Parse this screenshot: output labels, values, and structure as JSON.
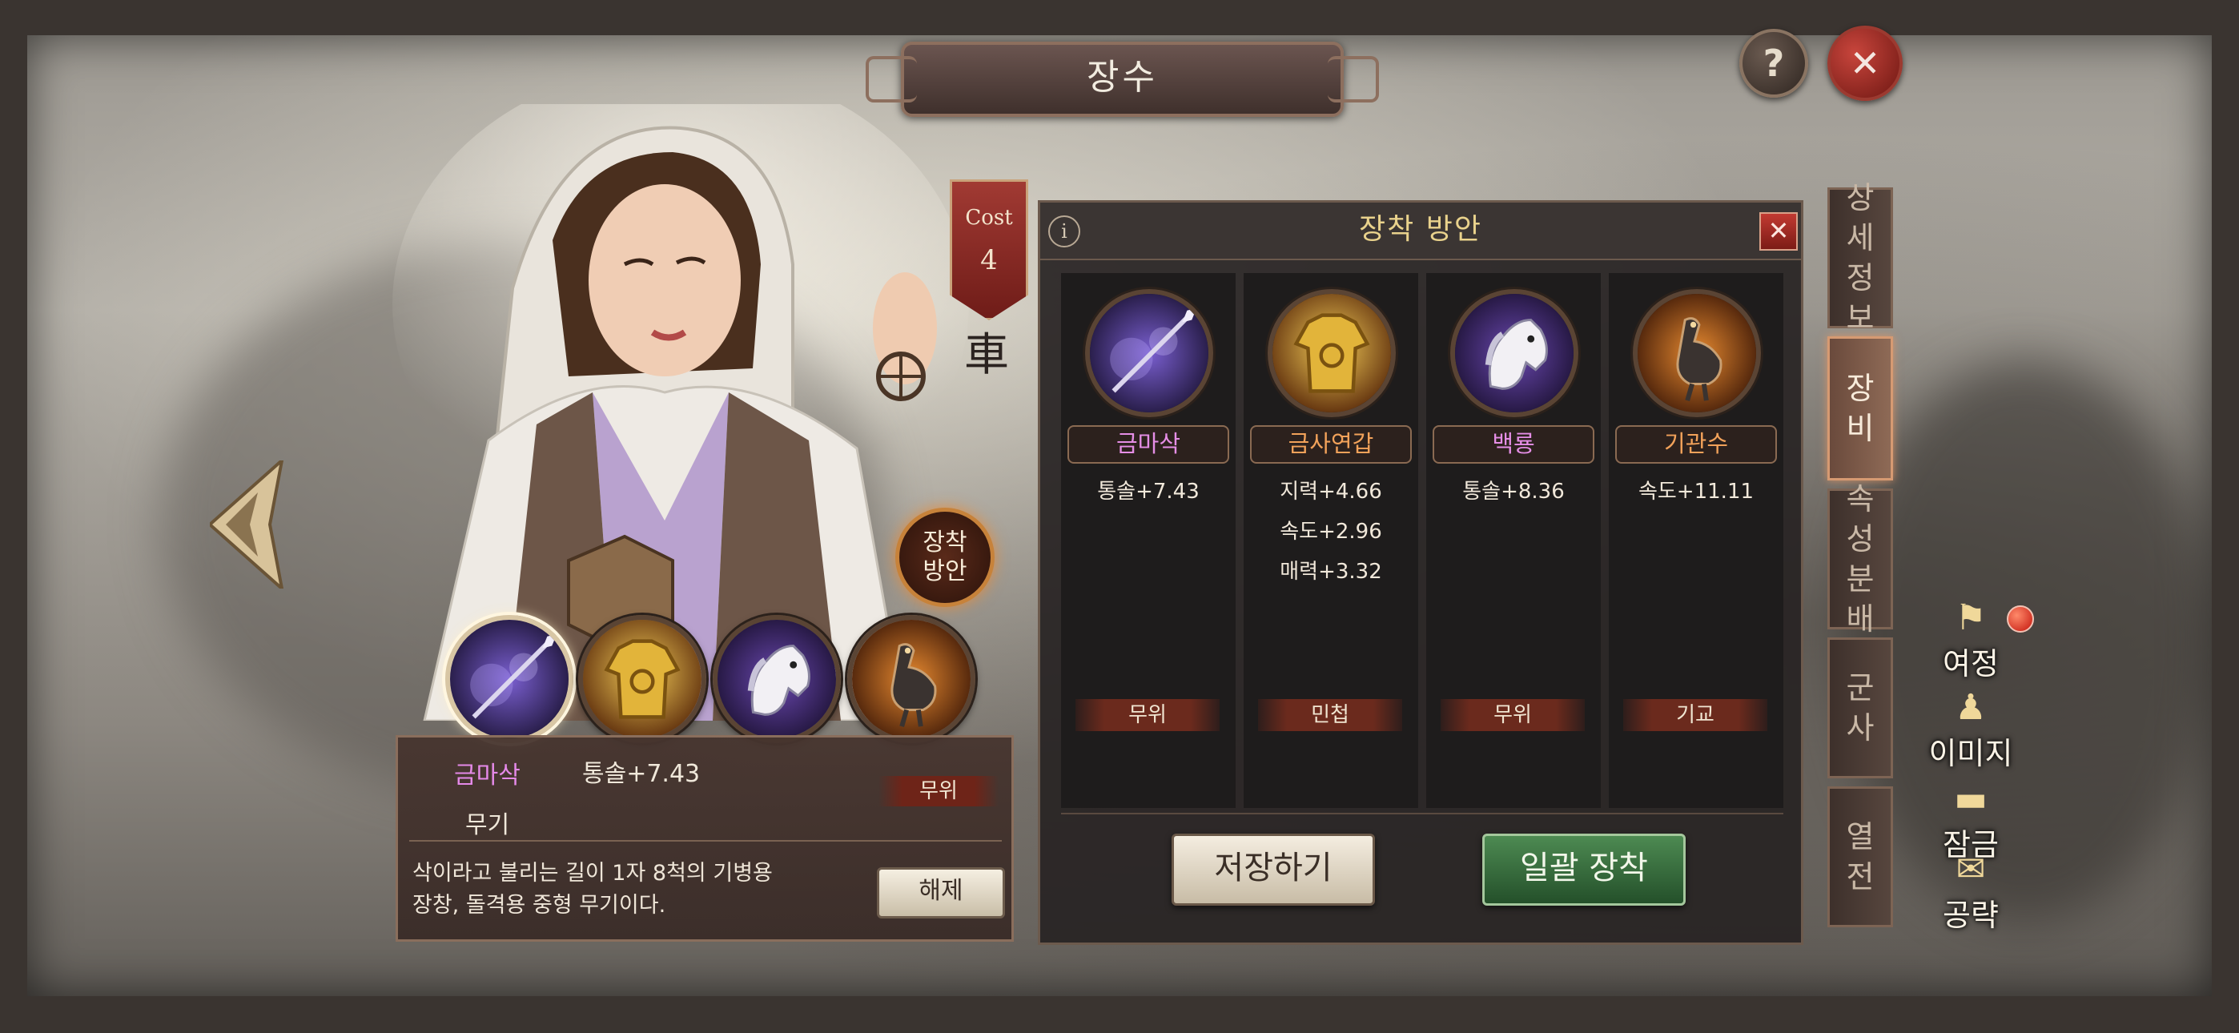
{
  "header": {
    "title": "장수"
  },
  "buttons": {
    "help_symbol": "?",
    "close_symbol": "✕"
  },
  "general": {
    "cost_label": "Cost",
    "cost_value": "4",
    "loadout_badge_line1": "장착",
    "loadout_badge_line2": "방안"
  },
  "equipped_slots": [
    {
      "icon": "spear-icon",
      "selected": true
    },
    {
      "icon": "golden-armor-icon",
      "selected": false
    },
    {
      "icon": "white-horse-icon",
      "selected": false
    },
    {
      "icon": "mechanical-bird-icon",
      "selected": false
    }
  ],
  "item_detail": {
    "name": "금마삭",
    "name_color": "#e489e8",
    "stat": "통솔+7.43",
    "type": "무기",
    "trait": "무위",
    "description_line1": "삭이라고 불리는 길이 1자 8척의 기병용",
    "description_line2": "장창, 돌격용 중형 무기이다.",
    "unequip_label": "해제"
  },
  "loadout": {
    "title": "장착 방안",
    "info_symbol": "i",
    "close_symbol": "✕",
    "columns": [
      {
        "icon": "spear-icon",
        "name": "금마삭",
        "name_color": "#e58ee6",
        "stats": [
          "통솔+7.43"
        ],
        "trait": "무위"
      },
      {
        "icon": "golden-armor-icon",
        "name": "금사연갑",
        "name_color": "#f2a25a",
        "stats": [
          "지력+4.66",
          "속도+2.96",
          "매력+3.32"
        ],
        "trait": "민첩"
      },
      {
        "icon": "white-horse-icon",
        "name": "백룡",
        "name_color": "#e58ee6",
        "stats": [
          "통솔+8.36"
        ],
        "trait": "무위"
      },
      {
        "icon": "mechanical-bird-icon",
        "name": "기관수",
        "name_color": "#f2a25a",
        "stats": [
          "속도+11.11"
        ],
        "trait": "기교"
      }
    ],
    "save_label": "저장하기",
    "equip_all_label": "일괄 장착"
  },
  "tabs": [
    {
      "label": [
        "상",
        "세",
        "정",
        "보"
      ],
      "active": false
    },
    {
      "label": [
        "장",
        "비"
      ],
      "active": true
    },
    {
      "label": [
        "속",
        "성",
        "분",
        "배"
      ],
      "active": false
    },
    {
      "label": [
        "군",
        "사"
      ],
      "active": false
    },
    {
      "label": [
        "열",
        "전"
      ],
      "active": false
    }
  ],
  "side_menu": [
    {
      "icon": "flag-icon",
      "label": "여정",
      "has_notification": true
    },
    {
      "icon": "figure-icon",
      "label": "이미지",
      "has_notification": false
    },
    {
      "icon": "lock-chest-icon",
      "label": "잠금",
      "has_notification": false
    },
    {
      "icon": "scroll-map-icon",
      "label": "공략",
      "has_notification": false
    }
  ]
}
